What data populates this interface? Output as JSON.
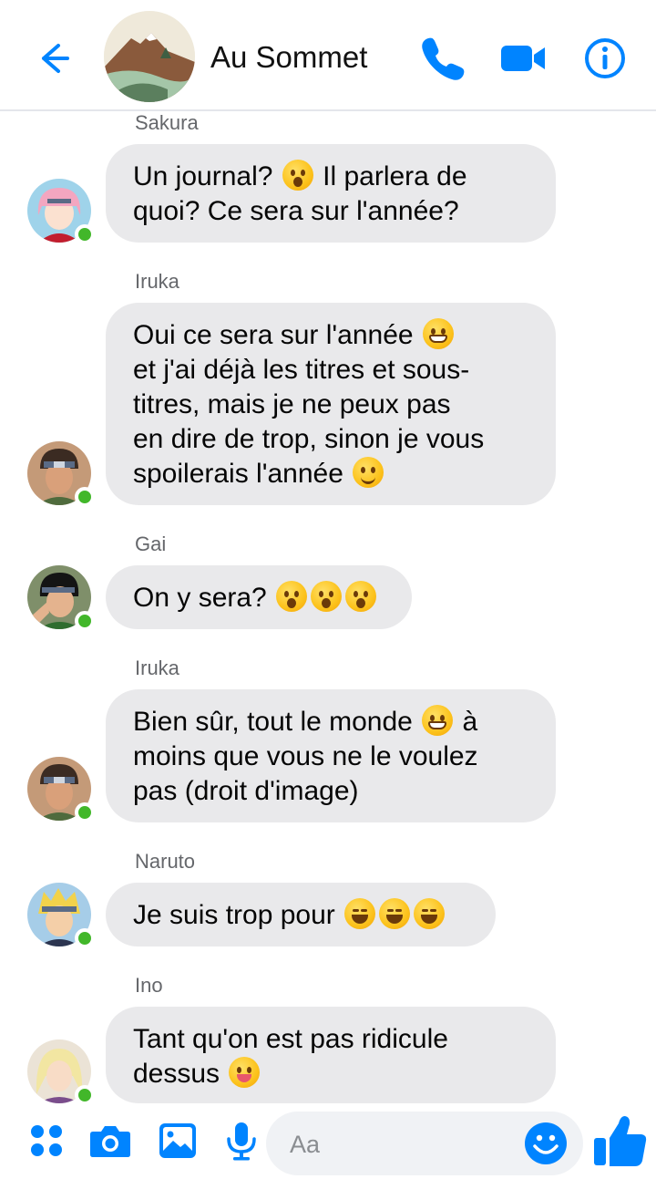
{
  "header": {
    "title": "Au Sommet",
    "accent_color": "#0084ff",
    "icons": [
      "arrow-left-icon",
      "phone-icon",
      "video-camera-icon",
      "info-icon"
    ]
  },
  "messages": [
    {
      "sender": "Sakura",
      "lines": [
        "Un journal? [astonished] Il parlera de",
        "quoi? Ce sera sur l'année?"
      ],
      "online": true
    },
    {
      "sender": "Iruka",
      "lines": [
        "Oui ce sera sur l'année [grin]",
        "et j'ai déjà les titres et sous-",
        "titres, mais je ne peux pas",
        "en dire de trop, sinon je vous",
        "spoilerais l'année [smirk]"
      ],
      "online": true
    },
    {
      "sender": "Gai",
      "lines": [
        "On y sera? [astonished][astonished][astonished]"
      ],
      "online": true
    },
    {
      "sender": "Iruka",
      "lines": [
        "Bien sûr, tout le monde [grin] à",
        "moins que vous ne le voulez",
        "pas (droit d'image)"
      ],
      "online": true
    },
    {
      "sender": "Naruto",
      "lines": [
        "Je suis trop pour [laugh][laugh][laugh]"
      ],
      "online": true
    },
    {
      "sender": "Ino",
      "lines": [
        "Tant qu'on est pas ridicule",
        "dessus [yum]"
      ],
      "online": true
    }
  ],
  "m0": {
    "sender": "Sakura",
    "l0a": "Un journal?",
    "l0b": "Il parlera de",
    "l1": "quoi? Ce sera sur l'année?"
  },
  "m1": {
    "sender": "Iruka",
    "l0": "Oui ce sera sur l'année",
    "l1": "et j'ai déjà les titres et sous-",
    "l2": "titres, mais je ne peux pas",
    "l3": "en dire de trop, sinon je vous",
    "l4": "spoilerais l'année"
  },
  "m2": {
    "sender": "Gai",
    "l0": "On y sera?"
  },
  "m3": {
    "sender": "Iruka",
    "l0a": "Bien sûr, tout le monde",
    "l0b": "à",
    "l1": "moins que vous ne le voulez",
    "l2": "pas (droit d'image)"
  },
  "m4": {
    "sender": "Naruto",
    "l0": "Je suis trop pour"
  },
  "m5": {
    "sender": "Ino",
    "l0": "Tant qu'on est pas ridicule",
    "l1": "dessus"
  },
  "composer": {
    "placeholder": "Aa",
    "icons": [
      "apps-grid-icon",
      "camera-icon",
      "image-icon",
      "microphone-icon",
      "emoji-icon",
      "thumbs-up-icon"
    ]
  },
  "colors": {
    "accent": "#0084ff",
    "bubble": "#e9e9eb",
    "online": "#42b72a"
  }
}
